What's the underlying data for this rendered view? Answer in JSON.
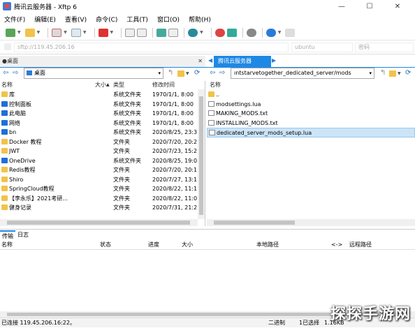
{
  "window": {
    "title": "腾讯云服务器 - Xftp 6",
    "controls": {
      "minimize": "—",
      "maximize": "☐",
      "close": "✕"
    }
  },
  "menu": [
    "文件(F)",
    "编辑(E)",
    "查看(V)",
    "命令(C)",
    "工具(T)",
    "窗口(O)",
    "帮助(H)"
  ],
  "address_bar": {
    "host": "sftp://119.45.206.16",
    "user": "ubuntu",
    "password": "密码"
  },
  "left_pane": {
    "tab_label": "桌面",
    "path": "桌面",
    "columns": {
      "name": "名称",
      "size": "大小",
      "type": "类型",
      "modified": "修改时间"
    },
    "rows": [
      {
        "name": "库",
        "size": "",
        "type": "系统文件夹",
        "modified": "1970/1/1, 8:00",
        "icon": "library-icon"
      },
      {
        "name": "控制面板",
        "size": "",
        "type": "系统文件夹",
        "modified": "1970/1/1, 8:00",
        "icon": "control-panel-icon"
      },
      {
        "name": "此电脑",
        "size": "",
        "type": "系统文件夹",
        "modified": "1970/1/1, 8:00",
        "icon": "computer-icon"
      },
      {
        "name": "网络",
        "size": "",
        "type": "系统文件夹",
        "modified": "1970/1/1, 8:00",
        "icon": "network-icon"
      },
      {
        "name": "bn",
        "size": "",
        "type": "系统文件夹",
        "modified": "2020/8/25, 23:3",
        "icon": "user-folder-icon"
      },
      {
        "name": "Docker 教程",
        "size": "",
        "type": "文件夹",
        "modified": "2020/7/20, 20:2",
        "icon": "folder-icon"
      },
      {
        "name": "JWT",
        "size": "",
        "type": "文件夹",
        "modified": "2020/7/23, 15:2",
        "icon": "folder-icon"
      },
      {
        "name": "OneDrive",
        "size": "",
        "type": "系统文件夹",
        "modified": "2020/8/25, 19:0",
        "icon": "onedrive-icon"
      },
      {
        "name": "Redis教程",
        "size": "",
        "type": "文件夹",
        "modified": "2020/7/20, 20:1",
        "icon": "folder-icon"
      },
      {
        "name": "Shiro",
        "size": "",
        "type": "文件夹",
        "modified": "2020/7/27, 13:1",
        "icon": "folder-icon"
      },
      {
        "name": "SpringCloud教程",
        "size": "",
        "type": "文件夹",
        "modified": "2020/8/22, 11:1",
        "icon": "folder-icon"
      },
      {
        "name": "【李永乐】2021考研...",
        "size": "",
        "type": "文件夹",
        "modified": "2020/8/22, 11:0",
        "icon": "folder-icon"
      },
      {
        "name": "健身记录",
        "size": "",
        "type": "文件夹",
        "modified": "2020/7/31, 21:2",
        "icon": "folder-icon"
      }
    ]
  },
  "right_pane": {
    "tab_label": "腾讯云服务器",
    "path": "ıntstarvetogether_dedicated_server/mods",
    "columns": {
      "name": "名称"
    },
    "rows": [
      {
        "name": "..",
        "icon": "folder-icon"
      },
      {
        "name": "modsettings.lua",
        "icon": "file-icon"
      },
      {
        "name": "MAKING_MODS.txt",
        "icon": "file-icon"
      },
      {
        "name": "INSTALLING_MODS.txt",
        "icon": "file-icon"
      },
      {
        "name": "dedicated_server_mods_setup.lua",
        "icon": "file-icon",
        "selected": true
      }
    ]
  },
  "bottom_tabs": [
    "传输",
    "日志"
  ],
  "transfer_columns": {
    "name": "名称",
    "status": "状态",
    "progress": "进度",
    "size": "大小",
    "local_path": "本地路径",
    "direction": "<->",
    "remote_path": "远程路径"
  },
  "status_bar": {
    "connection": "已连接 119.45.206.16:22。",
    "mode": "二进制",
    "selected": "1已选择",
    "size": "1.16KB"
  },
  "watermark": "探探手游网",
  "colors": {
    "accent": "#1e88e5",
    "folder": "#f2c34a"
  }
}
